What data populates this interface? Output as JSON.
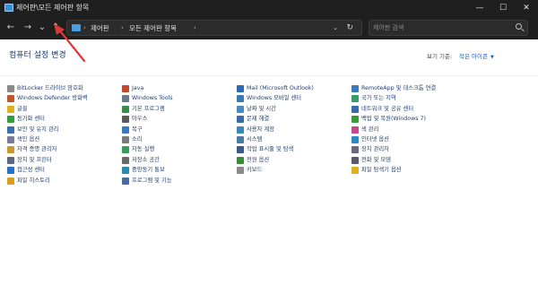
{
  "window": {
    "title": "제어판\\모든 제어판 항목",
    "controls": {
      "minimize": "—",
      "maximize": "☐",
      "close": "✕"
    }
  },
  "nav": {
    "back_icon": "←",
    "forward_icon": "→",
    "recent_icon": "⌄",
    "up_icon": "↑",
    "breadcrumbs": [
      "제어판",
      "모든 제어판 항목"
    ],
    "separator": "›",
    "dropdown_icon": "⌄",
    "refresh_icon": "↻",
    "search_placeholder": "제어판 검색"
  },
  "content": {
    "heading": "컴퓨터 설정 변경",
    "view_by_label": "보기 기준:",
    "view_by_value": "작은 아이콘",
    "columns": [
      [
        {
          "label": "BitLocker 드라이브 암호화",
          "icon": "bitlocker-icon",
          "color": "#8a8a8a"
        },
        {
          "label": "Windows Defender 방화벽",
          "icon": "firewall-icon",
          "color": "#c0562c"
        },
        {
          "label": "글꼴",
          "icon": "fonts-icon",
          "color": "#e0b020"
        },
        {
          "label": "동기화 센터",
          "icon": "sync-center-icon",
          "color": "#2e9e3e"
        },
        {
          "label": "보안 및 유지 관리",
          "icon": "security-maintenance-icon",
          "color": "#3a6fb0"
        },
        {
          "label": "색인 옵션",
          "icon": "indexing-options-icon",
          "color": "#7a7a9a"
        },
        {
          "label": "자격 증명 관리자",
          "icon": "credential-manager-icon",
          "color": "#c89a30"
        },
        {
          "label": "장치 및 프린터",
          "icon": "devices-printers-icon",
          "color": "#5a6a7a"
        },
        {
          "label": "접근성 센터",
          "icon": "ease-of-access-icon",
          "color": "#2a70c8"
        },
        {
          "label": "파일 히스토리",
          "icon": "file-history-icon",
          "color": "#d8a020"
        }
      ],
      [
        {
          "label": "Java",
          "icon": "java-icon",
          "color": "#c04a2a"
        },
        {
          "label": "Windows Tools",
          "icon": "windows-tools-icon",
          "color": "#6a7a8a"
        },
        {
          "label": "기본 프로그램",
          "icon": "default-programs-icon",
          "color": "#3a8a4a"
        },
        {
          "label": "마우스",
          "icon": "mouse-icon",
          "color": "#5a5a5a"
        },
        {
          "label": "복구",
          "icon": "recovery-icon",
          "color": "#3a78c0"
        },
        {
          "label": "소리",
          "icon": "sound-icon",
          "color": "#7a7a7a"
        },
        {
          "label": "자동 실행",
          "icon": "autoplay-icon",
          "color": "#3a9a5a"
        },
        {
          "label": "저장소 공간",
          "icon": "storage-spaces-icon",
          "color": "#6a6a6a"
        },
        {
          "label": "중앙동기 통보",
          "icon": "notification-icon",
          "color": "#2a8ab0"
        },
        {
          "label": "프로그램 및 기능",
          "icon": "programs-features-icon",
          "color": "#4a6aa0"
        }
      ],
      [
        {
          "label": "Mail (Microsoft Outlook)",
          "icon": "mail-icon",
          "color": "#2a6ab8"
        },
        {
          "label": "Windows 모바일 센터",
          "icon": "mobility-center-icon",
          "color": "#3a7ab0"
        },
        {
          "label": "날짜 및 시간",
          "icon": "date-time-icon",
          "color": "#4a8ac0"
        },
        {
          "label": "문제 해결",
          "icon": "troubleshooting-icon",
          "color": "#3a6aa8"
        },
        {
          "label": "사용자 계정",
          "icon": "user-accounts-icon",
          "color": "#3a8ab8"
        },
        {
          "label": "시스템",
          "icon": "system-icon",
          "color": "#4a7aa0"
        },
        {
          "label": "작업 표시줄 및 탐색",
          "icon": "taskbar-icon",
          "color": "#3a5a8a"
        },
        {
          "label": "전원 옵션",
          "icon": "power-options-icon",
          "color": "#3a8a3a"
        },
        {
          "label": "키보드",
          "icon": "keyboard-icon",
          "color": "#8a8a8a"
        }
      ],
      [
        {
          "label": "RemoteApp 및 데스크톱 연결",
          "icon": "remoteapp-icon",
          "color": "#3a7ab8"
        },
        {
          "label": "국가 또는 지역",
          "icon": "region-icon",
          "color": "#3a9a6a"
        },
        {
          "label": "네트워크 및 공유 센터",
          "icon": "network-sharing-icon",
          "color": "#3a6aa8"
        },
        {
          "label": "백업 및 복원(Windows 7)",
          "icon": "backup-restore-icon",
          "color": "#3a9a3a"
        },
        {
          "label": "색 관리",
          "icon": "color-management-icon",
          "color": "#c04a8a"
        },
        {
          "label": "인터넷 옵션",
          "icon": "internet-options-icon",
          "color": "#2a8ac8"
        },
        {
          "label": "장치 관리자",
          "icon": "device-manager-icon",
          "color": "#6a6a7a"
        },
        {
          "label": "전화 및 모뎀",
          "icon": "phone-modem-icon",
          "color": "#5a5a6a"
        },
        {
          "label": "파일 탐색기 옵션",
          "icon": "file-explorer-options-icon",
          "color": "#e0b020"
        }
      ]
    ]
  },
  "annotation": {
    "color": "#d93a3a"
  }
}
